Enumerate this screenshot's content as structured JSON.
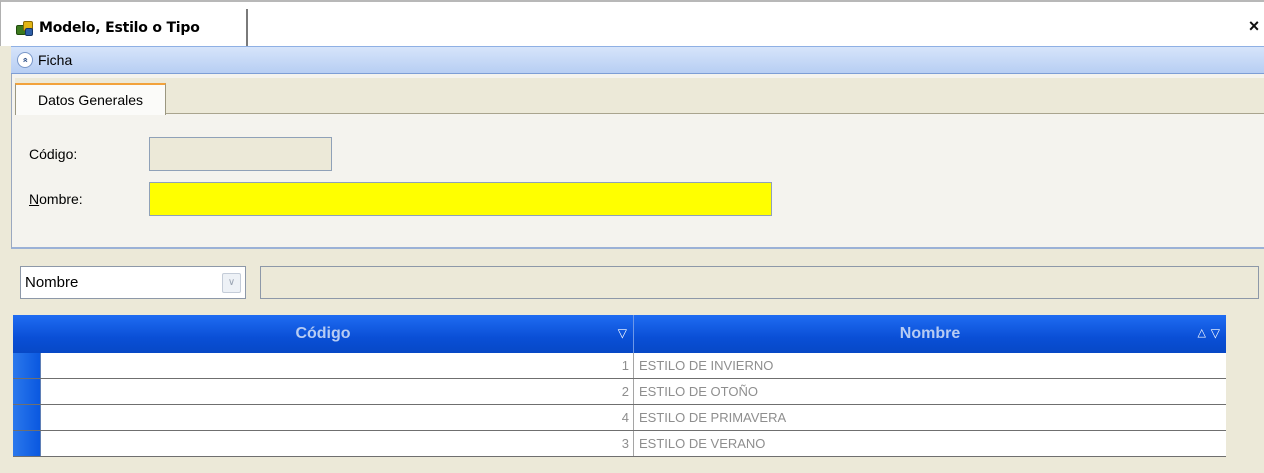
{
  "window": {
    "title": "Modelo, Estilo o Tipo",
    "close_symbol": "×",
    "icon": "cubes-icon"
  },
  "ficha": {
    "label": "Ficha",
    "collapse_symbol": "«"
  },
  "form": {
    "tabs": [
      {
        "label": "Datos Generales",
        "active": true
      }
    ],
    "codigo_label": "Código:",
    "codigo_value": "",
    "nombre_label_prefix": "N",
    "nombre_label_rest": "ombre:",
    "nombre_value": "",
    "nombre_highlight_color": "#ffff00"
  },
  "filter": {
    "field_selected": "Nombre",
    "search_value": ""
  },
  "grid": {
    "columns": [
      {
        "label": "Código",
        "icons": [
          "filter-icon"
        ]
      },
      {
        "label": "Nombre",
        "icons": [
          "sort-asc-icon",
          "filter-icon"
        ]
      }
    ],
    "rows": [
      {
        "codigo": "1",
        "nombre": "ESTILO DE INVIERNO"
      },
      {
        "codigo": "2",
        "nombre": "ESTILO DE OTOÑO"
      },
      {
        "codigo": "4",
        "nombre": "ESTILO DE PRIMAVERA"
      },
      {
        "codigo": "3",
        "nombre": "ESTILO DE VERANO"
      }
    ],
    "header_color": "#0a4fd6",
    "selector_color": "#0a58e0"
  }
}
